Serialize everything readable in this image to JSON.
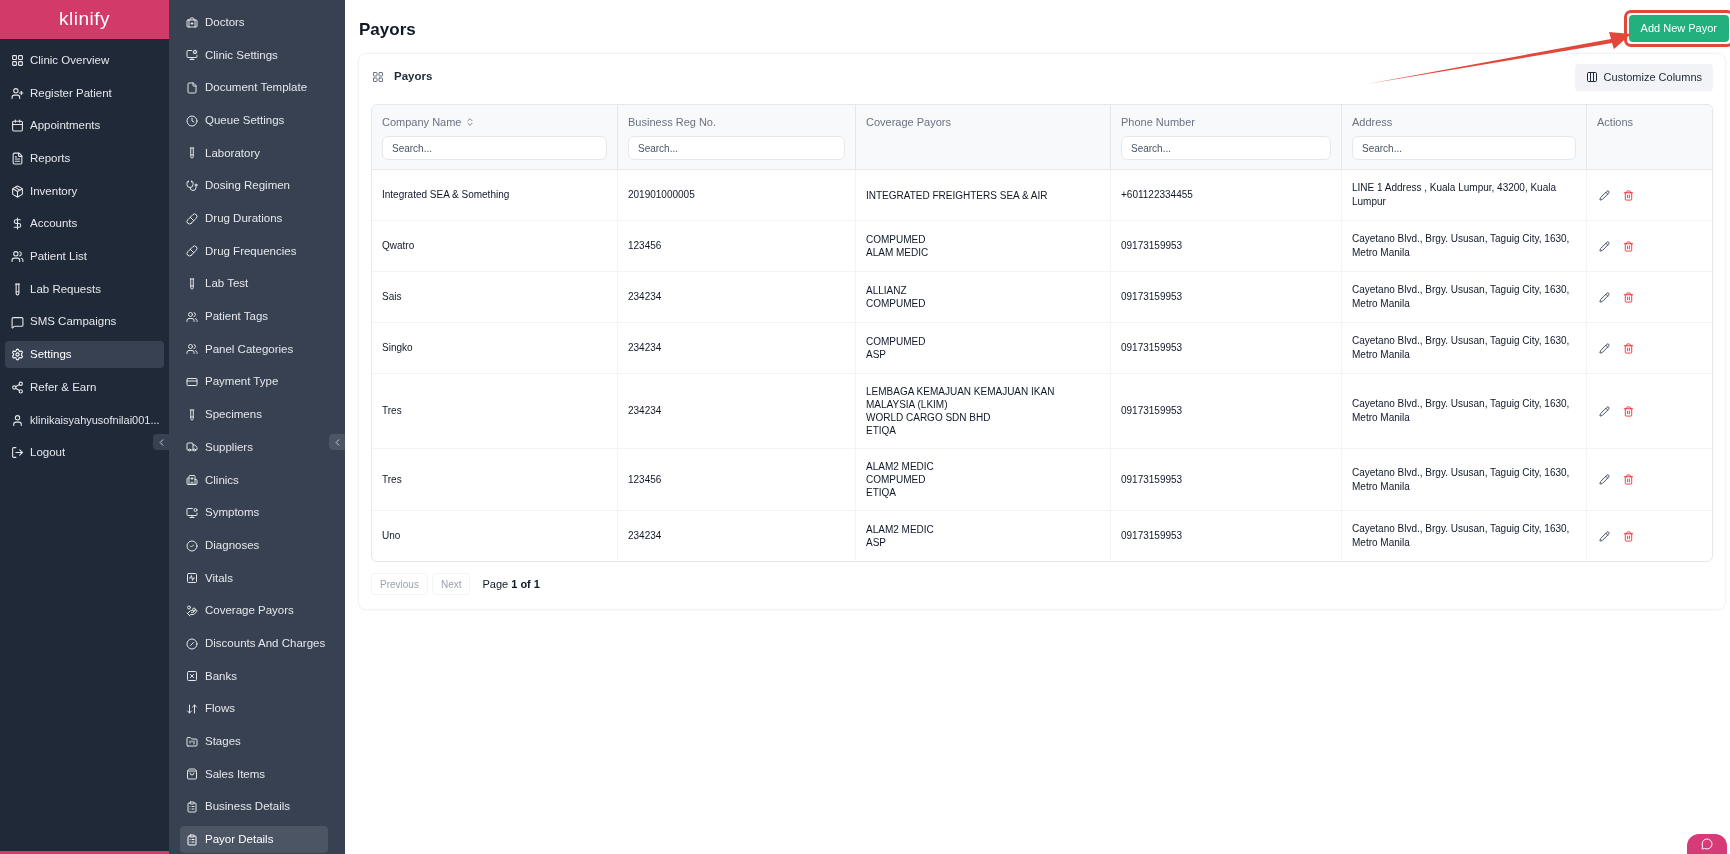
{
  "brand": "klinify",
  "main_nav": [
    {
      "label": "Clinic Overview",
      "selected": false
    },
    {
      "label": "Register Patient",
      "selected": false
    },
    {
      "label": "Appointments",
      "selected": false
    },
    {
      "label": "Reports",
      "selected": false
    },
    {
      "label": "Inventory",
      "selected": false
    },
    {
      "label": "Accounts",
      "selected": false
    },
    {
      "label": "Patient List",
      "selected": false
    },
    {
      "label": "Lab Requests",
      "selected": false
    },
    {
      "label": "SMS Campaigns",
      "selected": false
    },
    {
      "label": "Settings",
      "selected": true
    },
    {
      "label": "Refer & Earn",
      "selected": false
    },
    {
      "label": "klinikaisyahyusofnilai001...",
      "selected": false
    },
    {
      "label": "Logout",
      "selected": false
    }
  ],
  "settings_nav": [
    {
      "label": "Doctors",
      "selected": false
    },
    {
      "label": "Clinic Settings",
      "selected": false
    },
    {
      "label": "Document Template",
      "selected": false
    },
    {
      "label": "Queue Settings",
      "selected": false
    },
    {
      "label": "Laboratory",
      "selected": false
    },
    {
      "label": "Dosing Regimen",
      "selected": false
    },
    {
      "label": "Drug Durations",
      "selected": false
    },
    {
      "label": "Drug Frequencies",
      "selected": false
    },
    {
      "label": "Lab Test",
      "selected": false
    },
    {
      "label": "Patient Tags",
      "selected": false
    },
    {
      "label": "Panel Categories",
      "selected": false
    },
    {
      "label": "Payment Type",
      "selected": false
    },
    {
      "label": "Specimens",
      "selected": false
    },
    {
      "label": "Suppliers",
      "selected": false
    },
    {
      "label": "Clinics",
      "selected": false
    },
    {
      "label": "Symptoms",
      "selected": false
    },
    {
      "label": "Diagnoses",
      "selected": false
    },
    {
      "label": "Vitals",
      "selected": false
    },
    {
      "label": "Coverage Payors",
      "selected": false
    },
    {
      "label": "Discounts And Charges",
      "selected": false
    },
    {
      "label": "Banks",
      "selected": false
    },
    {
      "label": "Flows",
      "selected": false
    },
    {
      "label": "Stages",
      "selected": false
    },
    {
      "label": "Sales Items",
      "selected": false
    },
    {
      "label": "Business Details",
      "selected": false
    },
    {
      "label": "Payor Details",
      "selected": true
    }
  ],
  "page_title": "Payors",
  "add_button": "Add New Payor",
  "card": {
    "title": "Payors",
    "customize_button": "Customize Columns"
  },
  "table": {
    "columns": [
      {
        "label": "Company Name",
        "sortable": true,
        "placeholder": "Search..."
      },
      {
        "label": "Business Reg No.",
        "sortable": false,
        "placeholder": "Search..."
      },
      {
        "label": "Coverage Payors",
        "sortable": false
      },
      {
        "label": "Phone Number",
        "sortable": false,
        "placeholder": "Search..."
      },
      {
        "label": "Address",
        "sortable": false,
        "placeholder": "Search..."
      },
      {
        "label": "Actions",
        "sortable": false
      }
    ],
    "rows": [
      {
        "company": "Integrated SEA & Something",
        "reg_no": "201901000005",
        "coverage": [
          "INTEGRATED FREIGHTERS SEA & AIR"
        ],
        "phone": "+601122334455",
        "address": "LINE 1 Address , Kuala Lumpur, 43200, Kuala Lumpur"
      },
      {
        "company": "Qwatro",
        "reg_no": "123456",
        "coverage": [
          "COMPUMED",
          "ALAM MEDIC"
        ],
        "phone": "09173159953",
        "address": "Cayetano Blvd., Brgy. Ususan, Taguig City, 1630, Metro Manila"
      },
      {
        "company": "Sais",
        "reg_no": "234234",
        "coverage": [
          "ALLIANZ",
          "COMPUMED"
        ],
        "phone": "09173159953",
        "address": "Cayetano Blvd., Brgy. Ususan, Taguig City, 1630, Metro Manila"
      },
      {
        "company": "Singko",
        "reg_no": "234234",
        "coverage": [
          "COMPUMED",
          "ASP"
        ],
        "phone": "09173159953",
        "address": "Cayetano Blvd., Brgy. Ususan, Taguig City, 1630, Metro Manila"
      },
      {
        "company": "Tres",
        "reg_no": "234234",
        "coverage": [
          "LEMBAGA KEMAJUAN KEMAJUAN IKAN MALAYSIA (LKIM)",
          "WORLD CARGO SDN BHD",
          "ETIQA"
        ],
        "phone": "09173159953",
        "address": "Cayetano Blvd., Brgy. Ususan, Taguig City, 1630, Metro Manila"
      },
      {
        "company": "Tres",
        "reg_no": "123456",
        "coverage": [
          "ALAM2 MEDIC",
          "COMPUMED",
          "ETIQA"
        ],
        "phone": "09173159953",
        "address": "Cayetano Blvd., Brgy. Ususan, Taguig City, 1630, Metro Manila"
      },
      {
        "company": "Uno",
        "reg_no": "234234",
        "coverage": [
          "ALAM2 MEDIC",
          "ASP"
        ],
        "phone": "09173159953",
        "address": "Cayetano Blvd., Brgy. Ususan, Taguig City, 1630, Metro Manila"
      }
    ]
  },
  "pagination": {
    "previous": "Previous",
    "previous_disabled": true,
    "next": "Next",
    "next_disabled": true,
    "page_label": "Page **1 of 1**"
  }
}
